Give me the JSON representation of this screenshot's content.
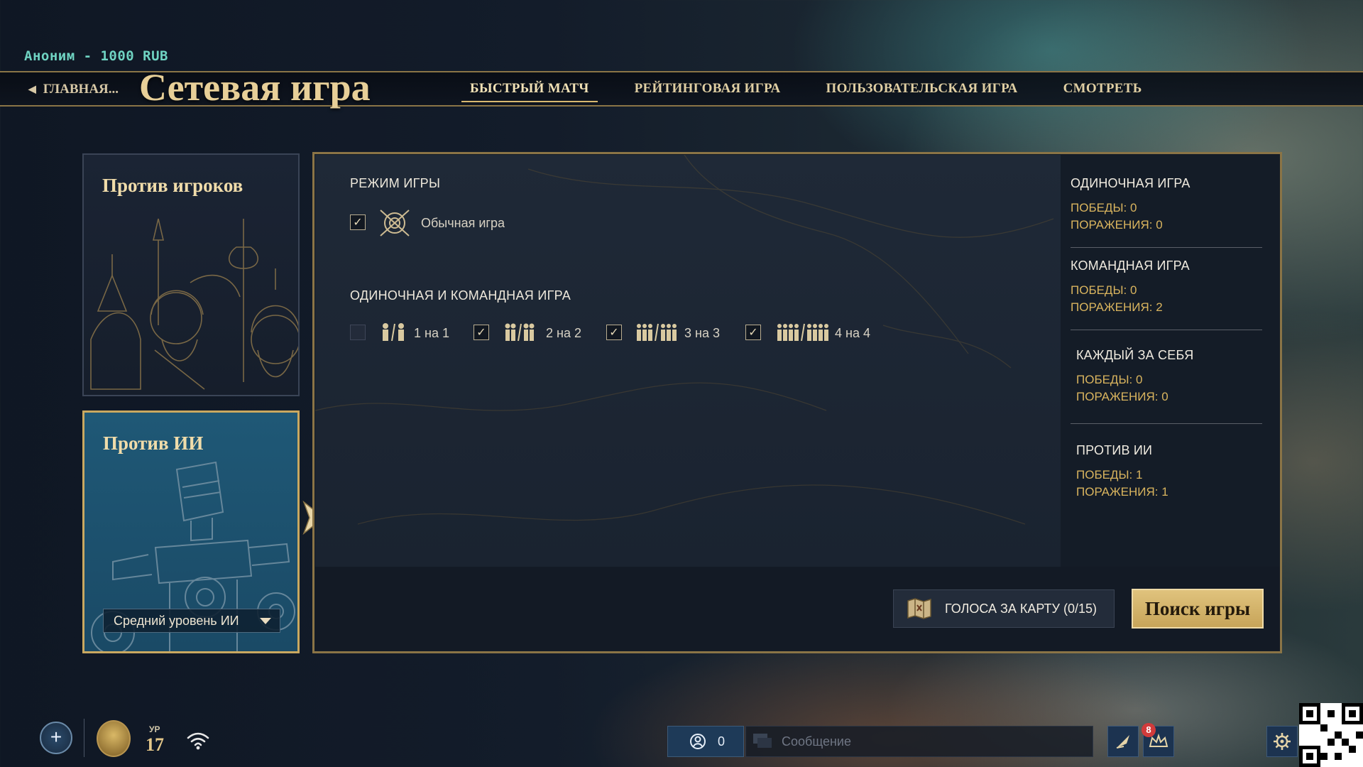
{
  "header": {
    "user": "Аноним - 1000 RUB",
    "back_label": "ГЛАВНАЯ...",
    "title": "Сетевая игра",
    "tabs": [
      {
        "label": "БЫСТРЫЙ МАТЧ",
        "active": true
      },
      {
        "label": "РЕЙТИНГОВАЯ ИГРА",
        "active": false
      },
      {
        "label": "ПОЛЬЗОВАТЕЛЬСКАЯ ИГРА",
        "active": false
      },
      {
        "label": "СМОТРЕТЬ",
        "active": false
      }
    ]
  },
  "modes": {
    "players_title": "Против игроков",
    "ai_title": "Против ИИ",
    "ai_difficulty": "Средний уровень ИИ",
    "selected": "ai"
  },
  "options": {
    "game_mode_label": "РЕЖИМ ИГРЫ",
    "normal_game": {
      "label": "Обычная игра",
      "checked": true
    },
    "team_label": "ОДИНОЧНАЯ И КОМАНДНАЯ ИГРА",
    "sizes": [
      {
        "label": "1 на 1",
        "checked": false
      },
      {
        "label": "2 на 2",
        "checked": true
      },
      {
        "label": "3 на 3",
        "checked": true
      },
      {
        "label": "4 на 4",
        "checked": true
      }
    ]
  },
  "stats": [
    {
      "head": "ОДИНОЧНАЯ ИГРА",
      "wins": "ПОБЕДЫ: 0",
      "losses": "ПОРАЖЕНИЯ: 0"
    },
    {
      "head": "КОМАНДНАЯ ИГРА",
      "wins": "ПОБЕДЫ: 0",
      "losses": "ПОРАЖЕНИЯ: 2"
    },
    {
      "head": "КАЖДЫЙ ЗА СЕБЯ",
      "wins": "ПОБЕДЫ: 0",
      "losses": "ПОРАЖЕНИЯ: 0"
    },
    {
      "head": "ПРОТИВ ИИ",
      "wins": "ПОБЕДЫ: 1",
      "losses": "ПОРАЖЕНИЯ: 1"
    }
  ],
  "actions": {
    "vote_label": "ГОЛОСА ЗА КАРТУ (0/15)",
    "search_label": "Поиск игры"
  },
  "bottom_bar": {
    "level_label": "УР",
    "level": "17",
    "friends_count": "0",
    "message_placeholder": "Сообщение",
    "notifications": "8"
  },
  "icons": {
    "back": "chevron-left-icon",
    "normal_game": "crossed-swords-shield-icon",
    "vote": "map-vote-icon",
    "friends": "friends-icon",
    "chat": "chat-bubble-icon",
    "wifi": "wifi-icon",
    "settings": "gear-icon"
  },
  "colors": {
    "accent_gold": "#e7cf98",
    "stat_gold": "#d9b45e",
    "user_teal": "#6fd3c2",
    "ai_card": "#1f5876"
  }
}
